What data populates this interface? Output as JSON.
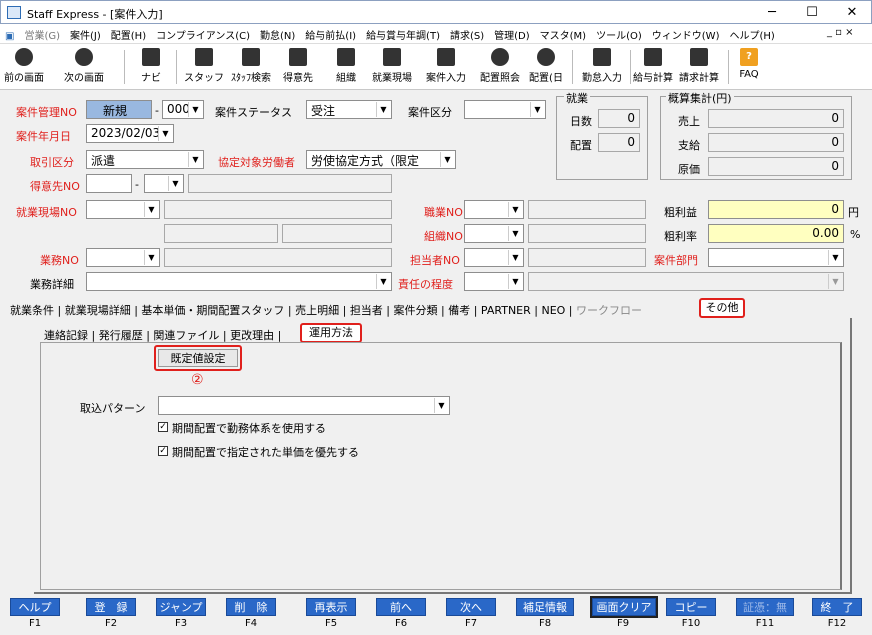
{
  "window": {
    "title": "Staff Express - [案件入力]",
    "minimize": "─",
    "maximize": "☐",
    "close": "✕"
  },
  "menu": {
    "items": [
      "営業(G)",
      "案件(J)",
      "配置(H)",
      "コンプライアンス(C)",
      "勤怠(N)",
      "給与前払(I)",
      "給与賞与年調(T)",
      "請求(S)",
      "管理(D)",
      "マスタ(M)",
      "ツール(O)",
      "ウィンドウ(W)",
      "ヘルプ(H)"
    ],
    "mdi_controls": "_ ▫ ×"
  },
  "toolbar": {
    "back": "前の画面",
    "forward": "次の画面",
    "navi": "ナビ",
    "buttons": [
      "スタッフ",
      "ｽﾀｯﾌ検索",
      "得意先",
      "組織",
      "就業現場",
      "案件入力",
      "配置照会",
      "配置(日",
      "勤怠入力",
      "給与計算",
      "請求計算",
      "FAQ"
    ]
  },
  "form": {
    "case_no_label": "案件管理NO",
    "case_no_value": "新規",
    "case_seq": "000",
    "status_label": "案件ステータス",
    "status_value": "受注",
    "category_label": "案件区分",
    "category_value": "",
    "date_label": "案件年月日",
    "date_value": "2023/02/03",
    "deal_label": "取引区分",
    "deal_value": "派遣",
    "agreement_label": "協定対象労働者",
    "agreement_value": "労使協定方式（限定",
    "client_label": "得意先NO",
    "client_sep": "-",
    "site_label": "就業現場NO",
    "job_label": "職業NO",
    "org_label": "組織NO",
    "work_label": "業務NO",
    "staff_label": "担当者NO",
    "dept_label": "案件部門",
    "detail_label": "業務詳細",
    "resp_label": "責任の程度",
    "gross_profit_label": "粗利益",
    "gross_profit_value": "0",
    "gross_profit_unit": "円",
    "gross_rate_label": "粗利率",
    "gross_rate_value": "0.00",
    "gross_rate_unit": "%"
  },
  "work_group": {
    "title": "就業",
    "days_label": "日数",
    "days_value": "0",
    "assign_label": "配置",
    "assign_value": "0"
  },
  "summary_group": {
    "title": "概算集計(円)",
    "sales_label": "売上",
    "sales_value": "0",
    "pay_label": "支給",
    "pay_value": "0",
    "cost_label": "原価",
    "cost_value": "0"
  },
  "tabs": [
    "就業条件",
    "就業現場詳細",
    "基本単価・期間配置スタッフ",
    "売上明細",
    "担当者",
    "案件分類",
    "備考",
    "PARTNER",
    "NEO",
    "ワークフロー",
    "その他"
  ],
  "subtabs": [
    "連絡記録",
    "発行履歴",
    "関連ファイル",
    "更改理由",
    "運用方法"
  ],
  "panel": {
    "default_button": "既定値設定",
    "marker": "②",
    "pattern_label": "取込パターン",
    "pattern_value": "",
    "check1": "期間配置で勤務体系を使用する",
    "check2": "期間配置で指定された単価を優先する"
  },
  "fkeys": [
    {
      "label": "ヘルプ",
      "key": "F1"
    },
    {
      "label": "登　録",
      "key": "F2"
    },
    {
      "label": "ジャンプ",
      "key": "F3"
    },
    {
      "label": "削　除",
      "key": "F4"
    },
    {
      "label": "再表示",
      "key": "F5"
    },
    {
      "label": "前へ",
      "key": "F6"
    },
    {
      "label": "次へ",
      "key": "F7"
    },
    {
      "label": "補足情報",
      "key": "F8"
    },
    {
      "label": "画面クリア",
      "key": "F9"
    },
    {
      "label": "コピー",
      "key": "F10"
    },
    {
      "label": "証憑：無",
      "key": "F11"
    },
    {
      "label": "終　了",
      "key": "F12"
    }
  ],
  "colors": {
    "accent_red": "#e0201c",
    "fkey_blue": "#2a68c8",
    "yellow_field": "#ffffc0"
  }
}
